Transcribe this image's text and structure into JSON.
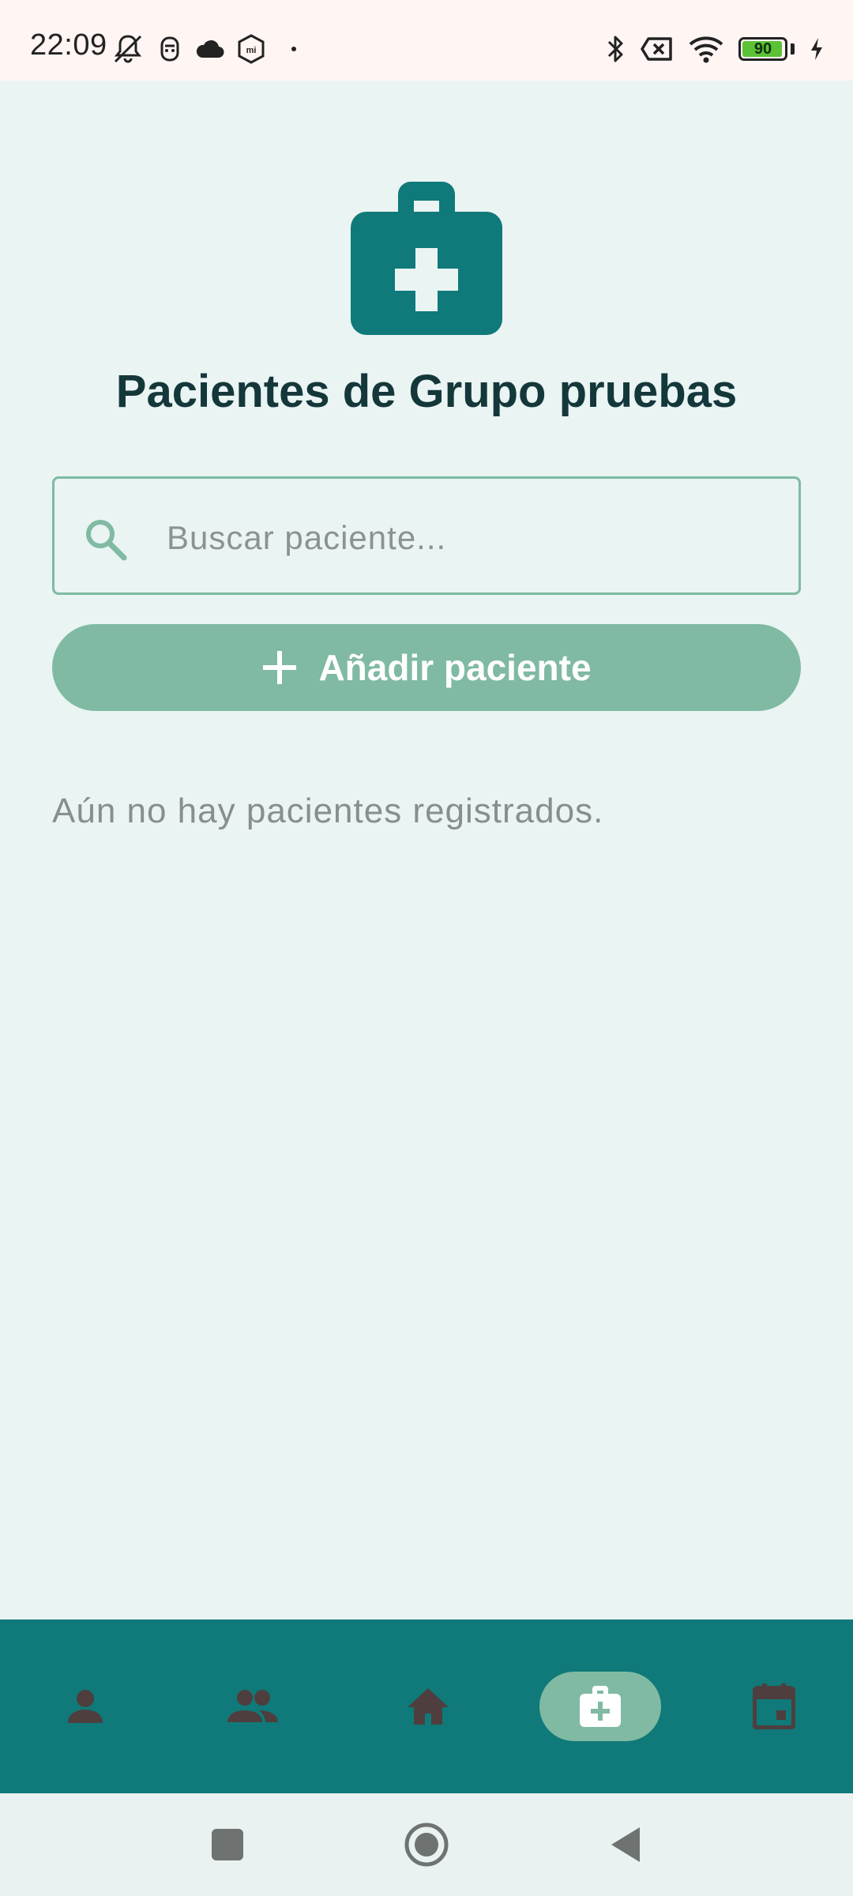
{
  "status_bar": {
    "time": "22:09",
    "left_icons": [
      "bell-off-icon",
      "face-icon",
      "cloud-icon",
      "mi-icon",
      "dot-icon"
    ],
    "right_icons": [
      "bluetooth-icon",
      "no-sim-icon",
      "wifi-icon",
      "battery-icon",
      "charging-icon"
    ],
    "battery_level": "90"
  },
  "header": {
    "icon": "medical-bag-icon",
    "title": "Pacientes de Grupo pruebas"
  },
  "search": {
    "icon": "search-icon",
    "placeholder": "Buscar paciente...",
    "value": ""
  },
  "add_button": {
    "icon": "plus-icon",
    "label": "Añadir paciente"
  },
  "empty_state": {
    "text": "Aún no hay pacientes registrados."
  },
  "bottom_nav": {
    "items": [
      {
        "icon": "person-icon",
        "selected": false
      },
      {
        "icon": "group-icon",
        "selected": false
      },
      {
        "icon": "home-icon",
        "selected": false
      },
      {
        "icon": "medical-bag-icon",
        "selected": true
      },
      {
        "icon": "calendar-icon",
        "selected": false
      }
    ]
  },
  "system_nav": {
    "buttons": [
      "recents-icon",
      "home-circle-icon",
      "back-icon"
    ]
  },
  "colors": {
    "background": "#E9F4F3",
    "primary": "#0F7A79",
    "accent": "#80BAA3",
    "title_text": "#14373A",
    "muted_text": "#888E8D"
  }
}
